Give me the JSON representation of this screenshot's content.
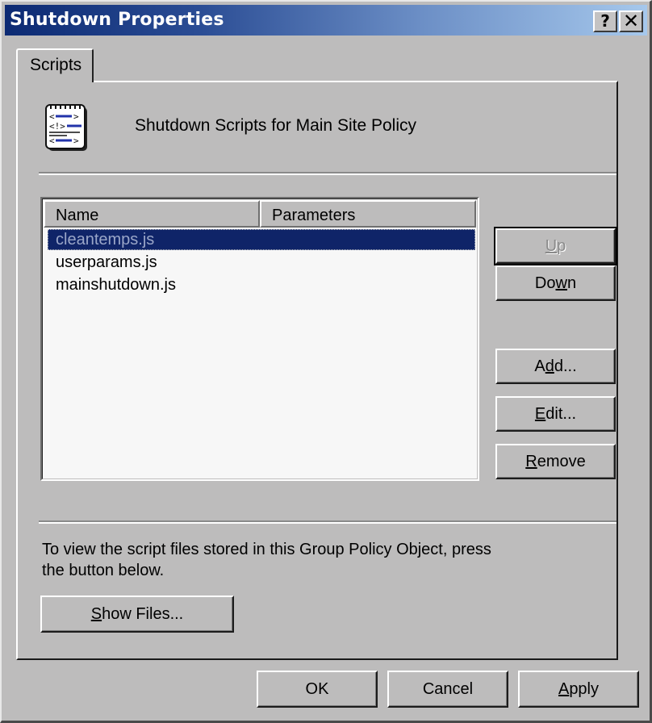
{
  "window": {
    "title": "Shutdown Properties",
    "help_button": "?",
    "close_button": "✕"
  },
  "tabs": [
    {
      "label": "Scripts",
      "active": true
    }
  ],
  "header": {
    "icon": "script-notepad-icon",
    "text": "Shutdown Scripts for Main Site Policy"
  },
  "list": {
    "columns": [
      "Name",
      "Parameters"
    ],
    "rows": [
      {
        "name": "cleantemps.js",
        "parameters": "",
        "selected": true
      },
      {
        "name": "userparams.js",
        "parameters": "",
        "selected": false
      },
      {
        "name": "mainshutdown.js",
        "parameters": "",
        "selected": false
      }
    ]
  },
  "side_buttons": {
    "up": {
      "pre": "",
      "accel": "U",
      "post": "p",
      "disabled": true,
      "focused": true
    },
    "down": {
      "pre": "Do",
      "accel": "w",
      "post": "n",
      "disabled": false
    },
    "add": {
      "pre": "A",
      "accel": "d",
      "post": "d...",
      "disabled": false
    },
    "edit": {
      "pre": "",
      "accel": "E",
      "post": "dit...",
      "disabled": false
    },
    "remove": {
      "pre": "",
      "accel": "R",
      "post": "emove",
      "disabled": false
    }
  },
  "info": {
    "line1": "To view the script files stored in this Group Policy Object, press",
    "line2": "the button below."
  },
  "show_files": {
    "pre": "",
    "accel": "S",
    "post": "how Files..."
  },
  "footer_buttons": {
    "ok": {
      "pre": "OK",
      "accel": "",
      "post": ""
    },
    "cancel": {
      "pre": "Cancel",
      "accel": "",
      "post": ""
    },
    "apply": {
      "pre": "",
      "accel": "A",
      "post": "pply"
    }
  },
  "colors": {
    "title_gradient_start": "#0c2a73",
    "title_gradient_end": "#a6c8ec",
    "face": "#bdbcbc",
    "selection": "#0f2468",
    "list_bg": "#f7f7f7"
  }
}
